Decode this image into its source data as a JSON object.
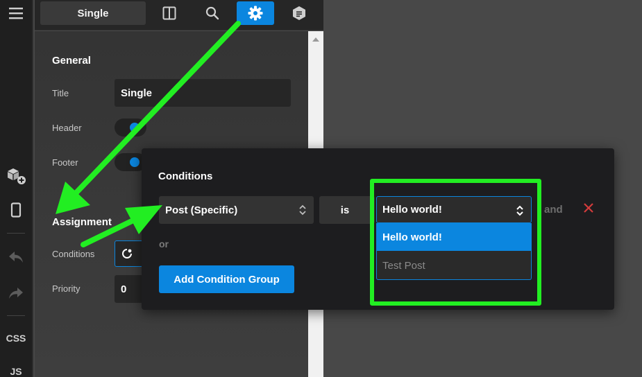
{
  "toolbar": {
    "items": [
      "hamburger-icon",
      "add-element-icon",
      "device-icon",
      "undo-icon",
      "redo-icon"
    ],
    "css_label": "CSS",
    "js_label": "JS"
  },
  "topbar": {
    "template_name": "Single",
    "icons": [
      "layout-icon",
      "search-icon",
      "settings-icon",
      "page-icon"
    ]
  },
  "panel": {
    "general_heading": "General",
    "title_label": "Title",
    "title_value": "Single",
    "header_label": "Header",
    "footer_label": "Footer",
    "assignment_heading": "Assignment",
    "conditions_label": "Conditions",
    "priority_label": "Priority",
    "priority_value": "0"
  },
  "conditions_popup": {
    "title": "Conditions",
    "rule_type": "Post (Specific)",
    "operator": "is",
    "value": "Hello world!",
    "options": [
      "Hello world!",
      "Test Post"
    ],
    "and_label": "and",
    "or_label": "or",
    "add_group_label": "Add Condition Group"
  },
  "colors": {
    "accent": "#0b86df",
    "annotation": "#22ee22",
    "remove": "#d33b3b"
  }
}
